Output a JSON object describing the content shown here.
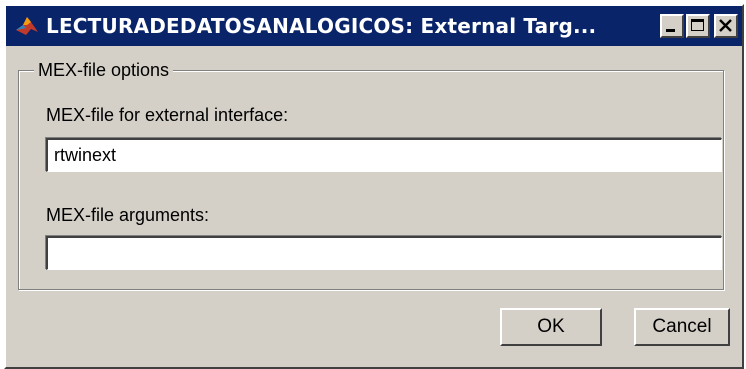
{
  "window": {
    "title": "LECTURADEDATOSANALOGICOS: External Targ...",
    "icon": "matlab-logo-icon",
    "controls": {
      "minimize_icon": "minimize-icon",
      "maximize_icon": "maximize-icon",
      "close_icon": "close-icon"
    }
  },
  "group": {
    "legend": "MEX-file options",
    "interface": {
      "label": "MEX-file for external interface:",
      "value": "rtwinext",
      "placeholder": ""
    },
    "arguments": {
      "label": "MEX-file arguments:",
      "value": "",
      "placeholder": ""
    }
  },
  "buttons": {
    "ok_label": "OK",
    "cancel_label": "Cancel"
  },
  "colors": {
    "titlebar": "#0a246a",
    "face": "#d4d0c8",
    "field": "#ffffff"
  }
}
